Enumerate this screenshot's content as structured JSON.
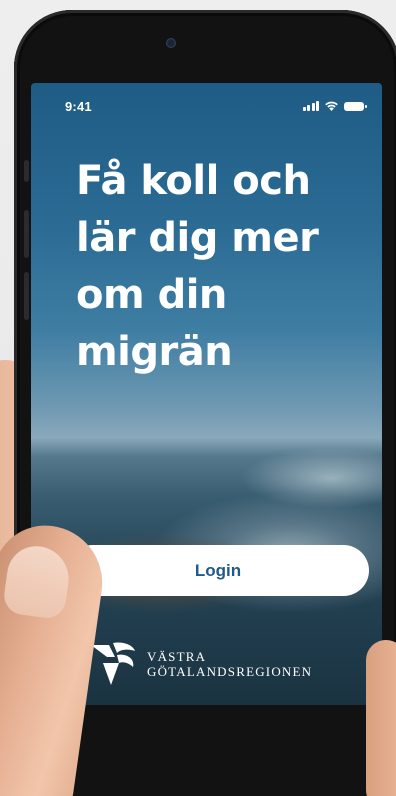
{
  "status_bar": {
    "time": "9:41",
    "icons": [
      "signal-icon",
      "wifi-icon",
      "battery-icon"
    ]
  },
  "hero": {
    "headline_lines": [
      "Få koll och",
      "lär dig mer",
      "om din",
      "migrän"
    ]
  },
  "login_button": {
    "label": "Login"
  },
  "brand": {
    "line1": "VÄSTRA",
    "line2": "GÖTALANDSREGIONEN",
    "icon": "vgr-logo-icon"
  },
  "colors": {
    "button_text": "#1f5a8a",
    "button_bg": "#ffffff",
    "headline": "#ffffff",
    "phone_frame": "#121212"
  }
}
